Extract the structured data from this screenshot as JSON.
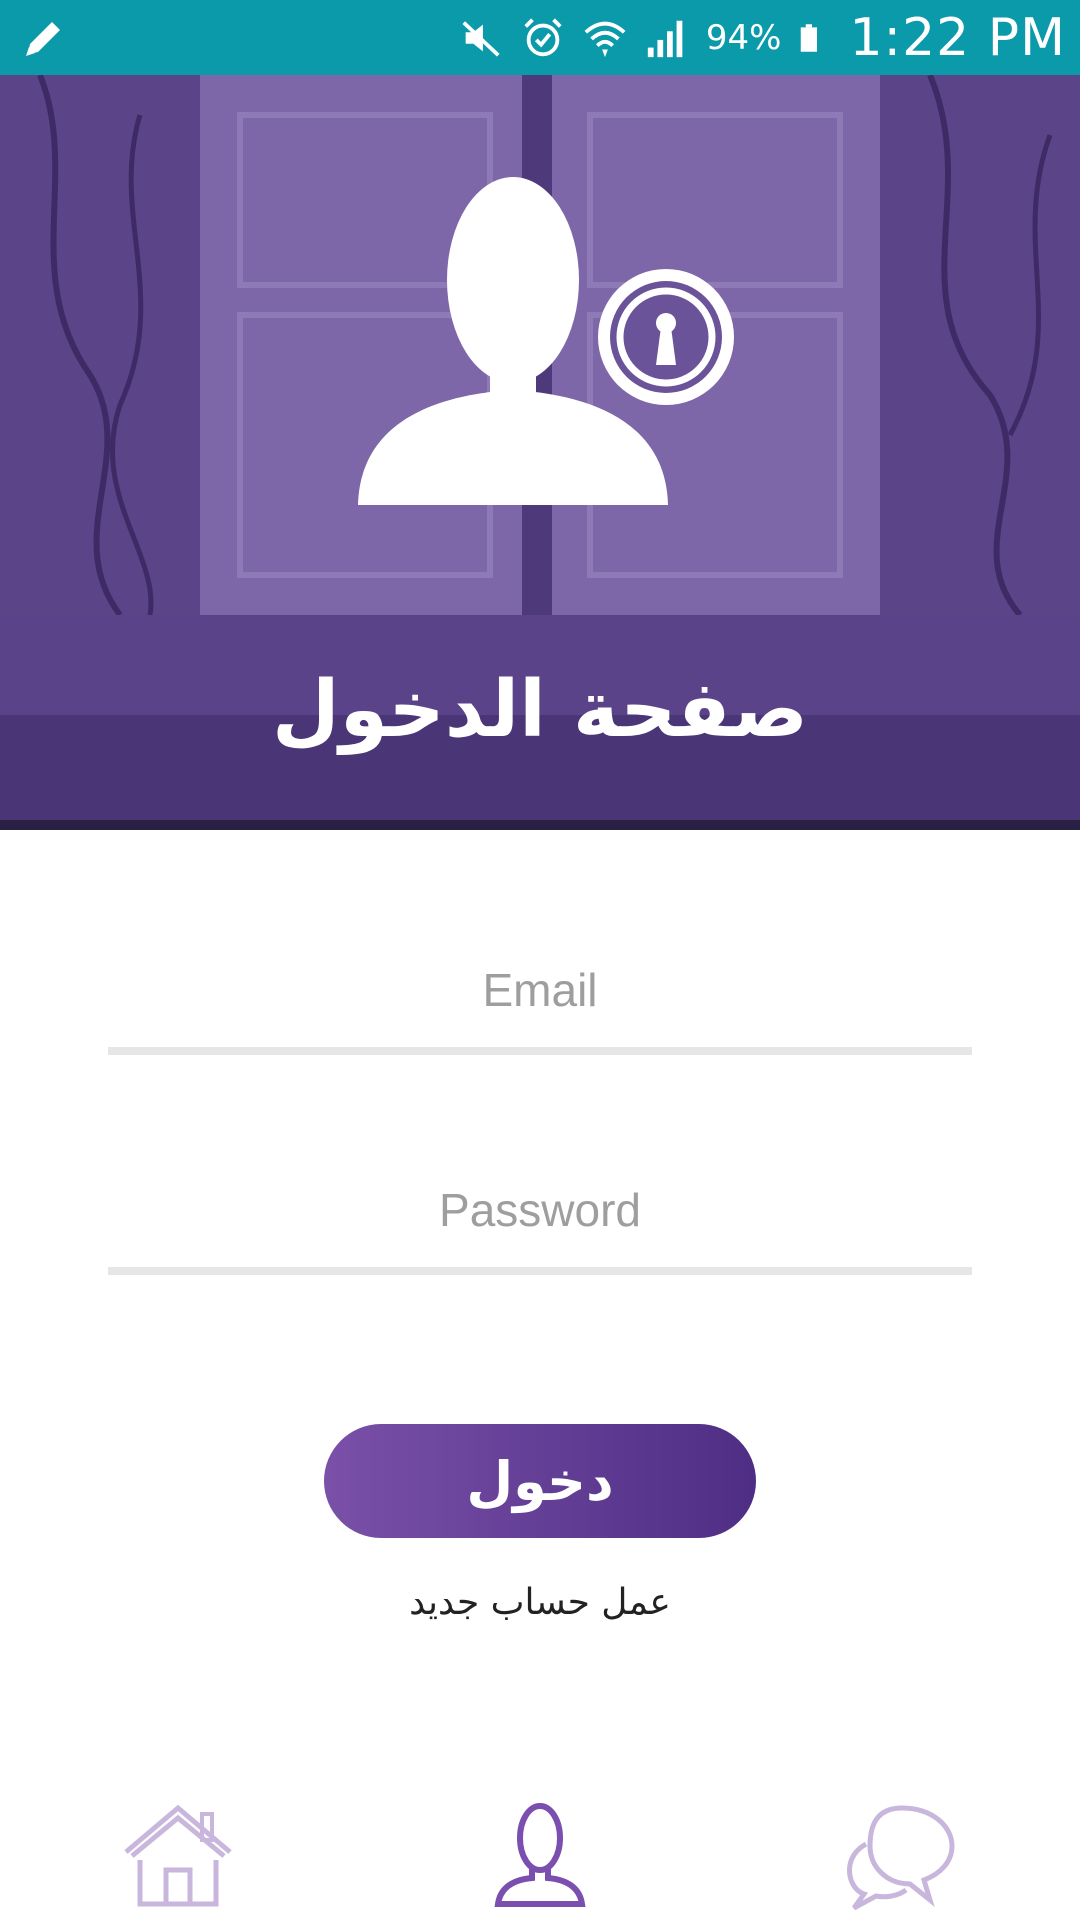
{
  "status_bar": {
    "battery_percent": "94%",
    "time": "1:22 PM",
    "icons": [
      "pencil-icon",
      "mute-icon",
      "alarm-icon",
      "wifi-icon",
      "signal-icon",
      "battery-icon"
    ]
  },
  "hero": {
    "title": "صفحة الدخول",
    "icon": "user-lock-icon",
    "overlay_color": "#5b3d8f"
  },
  "form": {
    "email_placeholder": "Email",
    "password_placeholder": "Password",
    "login_label": "دخول",
    "register_label": "عمل حساب جديد"
  },
  "bottom_nav": {
    "items": [
      {
        "icon": "home-icon",
        "active": false
      },
      {
        "icon": "user-icon",
        "active": true
      },
      {
        "icon": "chat-icon",
        "active": false
      }
    ]
  },
  "colors": {
    "status_bar": "#0a9aaa",
    "accent": "#6a3fa0",
    "nav_inactive": "#c8b6dc",
    "nav_active": "#7a4fb0"
  }
}
